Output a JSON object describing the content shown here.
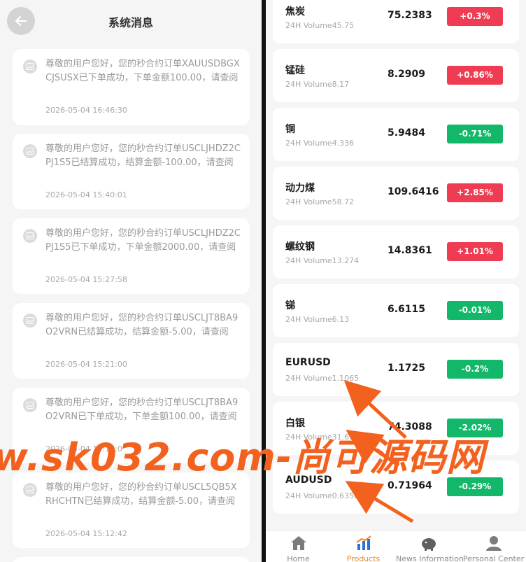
{
  "left": {
    "title": "系统消息",
    "messages": [
      {
        "text": "尊敬的用户您好，您的秒合约订单XAUUSDBGXCJSUSX已下单成功，下单金额100.00，请查阅",
        "time": "2026-05-04 16:46:30"
      },
      {
        "text": "尊敬的用户您好，您的秒合约订单USCLJHDZ2CPJ1S5已结算成功，结算金额-100.00，请查阅",
        "time": "2026-05-04 15:40:01"
      },
      {
        "text": "尊敬的用户您好，您的秒合约订单USCLJHDZ2CPJ1S5已下单成功，下单金额2000.00，请查阅",
        "time": "2026-05-04 15:27:58"
      },
      {
        "text": "尊敬的用户您好，您的秒合约订单USCLJT8BA9O2VRN已结算成功，结算金额-5.00，请查阅",
        "time": "2026-05-04 15:21:00"
      },
      {
        "text": "尊敬的用户您好，您的秒合约订单USCLJT8BA9O2VRN已下单成功，下单金额100.00，请查阅",
        "time": "2026-05-04 15:13:0"
      },
      {
        "text": "尊敬的用户您好，您的秒合约订单USCL5QB5XRHCHTN已结算成功，结算金额-5.00，请查阅",
        "time": "2026-05-04 15:12:42"
      }
    ]
  },
  "right": {
    "products": [
      {
        "name": "焦炭",
        "volume": "24H Volume45.75",
        "price": "75.2383",
        "change": "+0.3%",
        "dir": "up"
      },
      {
        "name": "锰硅",
        "volume": "24H Volume8.17",
        "price": "8.2909",
        "change": "+0.86%",
        "dir": "up"
      },
      {
        "name": "铜",
        "volume": "24H Volume4.336",
        "price": "5.9484",
        "change": "-0.71%",
        "dir": "down"
      },
      {
        "name": "动力煤",
        "volume": "24H Volume58.72",
        "price": "109.6416",
        "change": "+2.85%",
        "dir": "up"
      },
      {
        "name": "螺纹钢",
        "volume": "24H Volume13.274",
        "price": "14.8361",
        "change": "+1.01%",
        "dir": "up"
      },
      {
        "name": "锑",
        "volume": "24H Volume6.13",
        "price": "6.6115",
        "change": "-0.01%",
        "dir": "down"
      },
      {
        "name": "EURUSD",
        "volume": "24H Volume1.1065",
        "price": "1.1725",
        "change": "-0.2%",
        "dir": "down"
      },
      {
        "name": "白银",
        "volume": "24H Volume31.63",
        "price": "74.3088",
        "change": "-2.02%",
        "dir": "down"
      },
      {
        "name": "AUDUSD",
        "volume": "24H Volume0.6356",
        "price": "0.71964",
        "change": "-0.29%",
        "dir": "down"
      }
    ],
    "tabs": [
      {
        "label": "Home",
        "icon": "home-icon"
      },
      {
        "label": "Products",
        "icon": "chart-icon",
        "active": true
      },
      {
        "label": "News Information",
        "icon": "piggy-bank-icon"
      },
      {
        "label": "Personal Center",
        "icon": "user-icon"
      }
    ]
  },
  "watermark": "w.sk032.com-尚可源码网",
  "colors": {
    "up": "#f03c52",
    "down": "#12b76a",
    "active_tab": "#e4882a",
    "watermark": "#f2621e"
  }
}
